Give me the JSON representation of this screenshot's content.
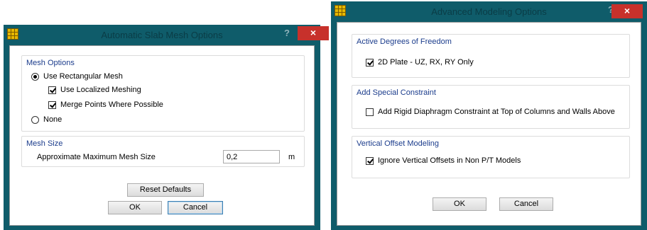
{
  "slab_dialog": {
    "title": "Automatic Slab Mesh Options",
    "help_label": "?",
    "close_label": "×",
    "mesh_options": {
      "group_title": "Mesh Options",
      "use_rectangular_mesh": "Use Rectangular Mesh",
      "use_localized_meshing": "Use Localized Meshing",
      "merge_points": "Merge Points Where Possible",
      "none": "None"
    },
    "mesh_size": {
      "group_title": "Mesh Size",
      "label": "Approximate Maximum Mesh Size",
      "value": "0,2",
      "unit": "m"
    },
    "reset_label": "Reset Defaults",
    "ok_label": "OK",
    "cancel_label": "Cancel"
  },
  "advanced_dialog": {
    "title": "Advanced Modeling Options",
    "help_label": "?",
    "close_label": "×",
    "dof": {
      "group_title": "Active Degrees of Freedom",
      "plate_label": "2D Plate - UZ, RX, RY Only"
    },
    "constraint": {
      "group_title": "Add Special Constraint",
      "diaphragm_label": "Add Rigid Diaphragm Constraint at Top of Columns and Walls Above"
    },
    "offset": {
      "group_title": "Vertical Offset Modeling",
      "ignore_label": "Ignore Vertical Offsets in Non P/T Models"
    },
    "ok_label": "OK",
    "cancel_label": "Cancel"
  },
  "colors": {
    "frame": "#0f5c6a",
    "title_text": "#0a3c46",
    "close_button": "#c7312b",
    "group_title": "#1b3c8c"
  }
}
